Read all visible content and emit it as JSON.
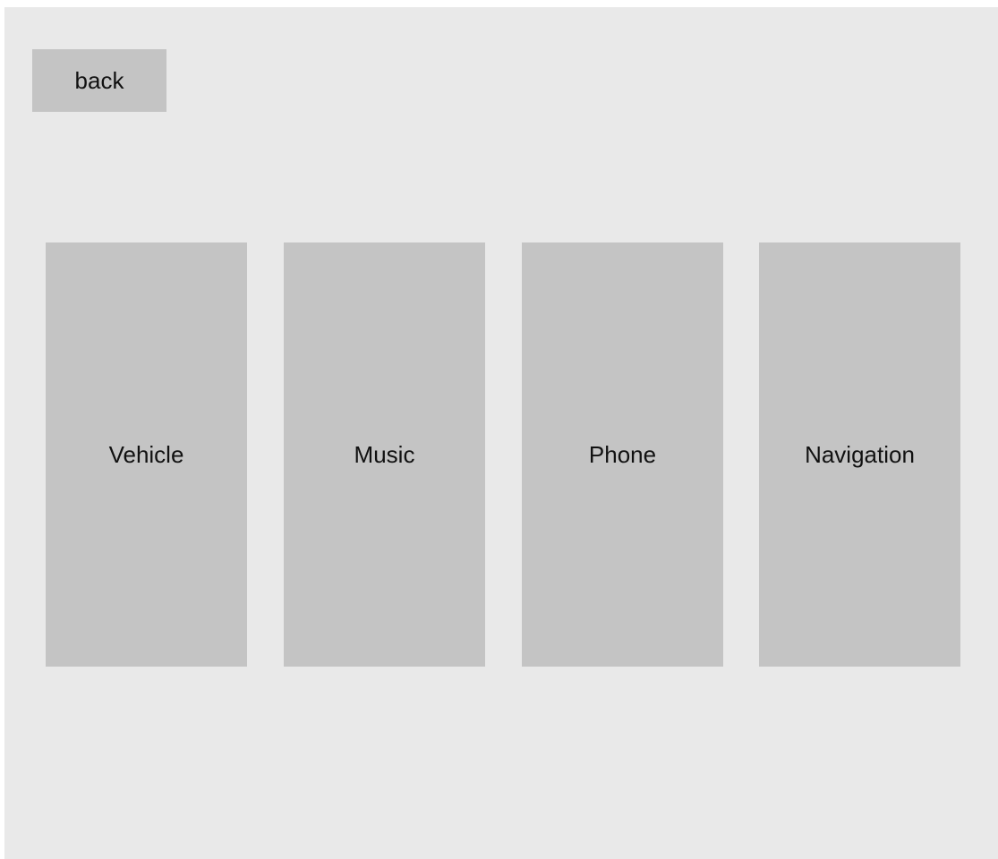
{
  "header": {
    "back_label": "back"
  },
  "menu": {
    "items": [
      {
        "label": "Vehicle"
      },
      {
        "label": "Music"
      },
      {
        "label": "Phone"
      },
      {
        "label": "Navigation"
      }
    ]
  },
  "colors": {
    "background": "#e9e9e9",
    "tile": "#c4c4c4",
    "text": "#111111"
  }
}
